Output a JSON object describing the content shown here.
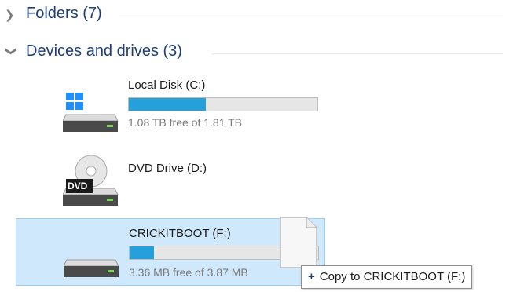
{
  "groups": [
    {
      "label": "Folders (7)",
      "expanded": false
    },
    {
      "label": "Devices and drives (3)",
      "expanded": true
    }
  ],
  "drives": [
    {
      "name": "Local Disk (C:)",
      "free_text": "1.08 TB free of 1.81 TB",
      "used_fraction": 0.41,
      "icon": "windows-drive-icon"
    },
    {
      "name": "DVD Drive (D:)",
      "icon": "dvd-drive-icon",
      "dvd_label": "DVD"
    },
    {
      "name": "CRICKITBOOT (F:)",
      "free_text": "3.36 MB free of 3.87 MB",
      "used_fraction": 0.13,
      "icon": "usb-drive-icon",
      "selected": true
    }
  ],
  "drag": {
    "tooltip_plus": "+",
    "tooltip_text": "Copy to CRICKITBOOT (F:)"
  },
  "colors": {
    "accent": "#26a0da",
    "heading": "#1e3f7a",
    "selection": "#cfe8fb"
  }
}
